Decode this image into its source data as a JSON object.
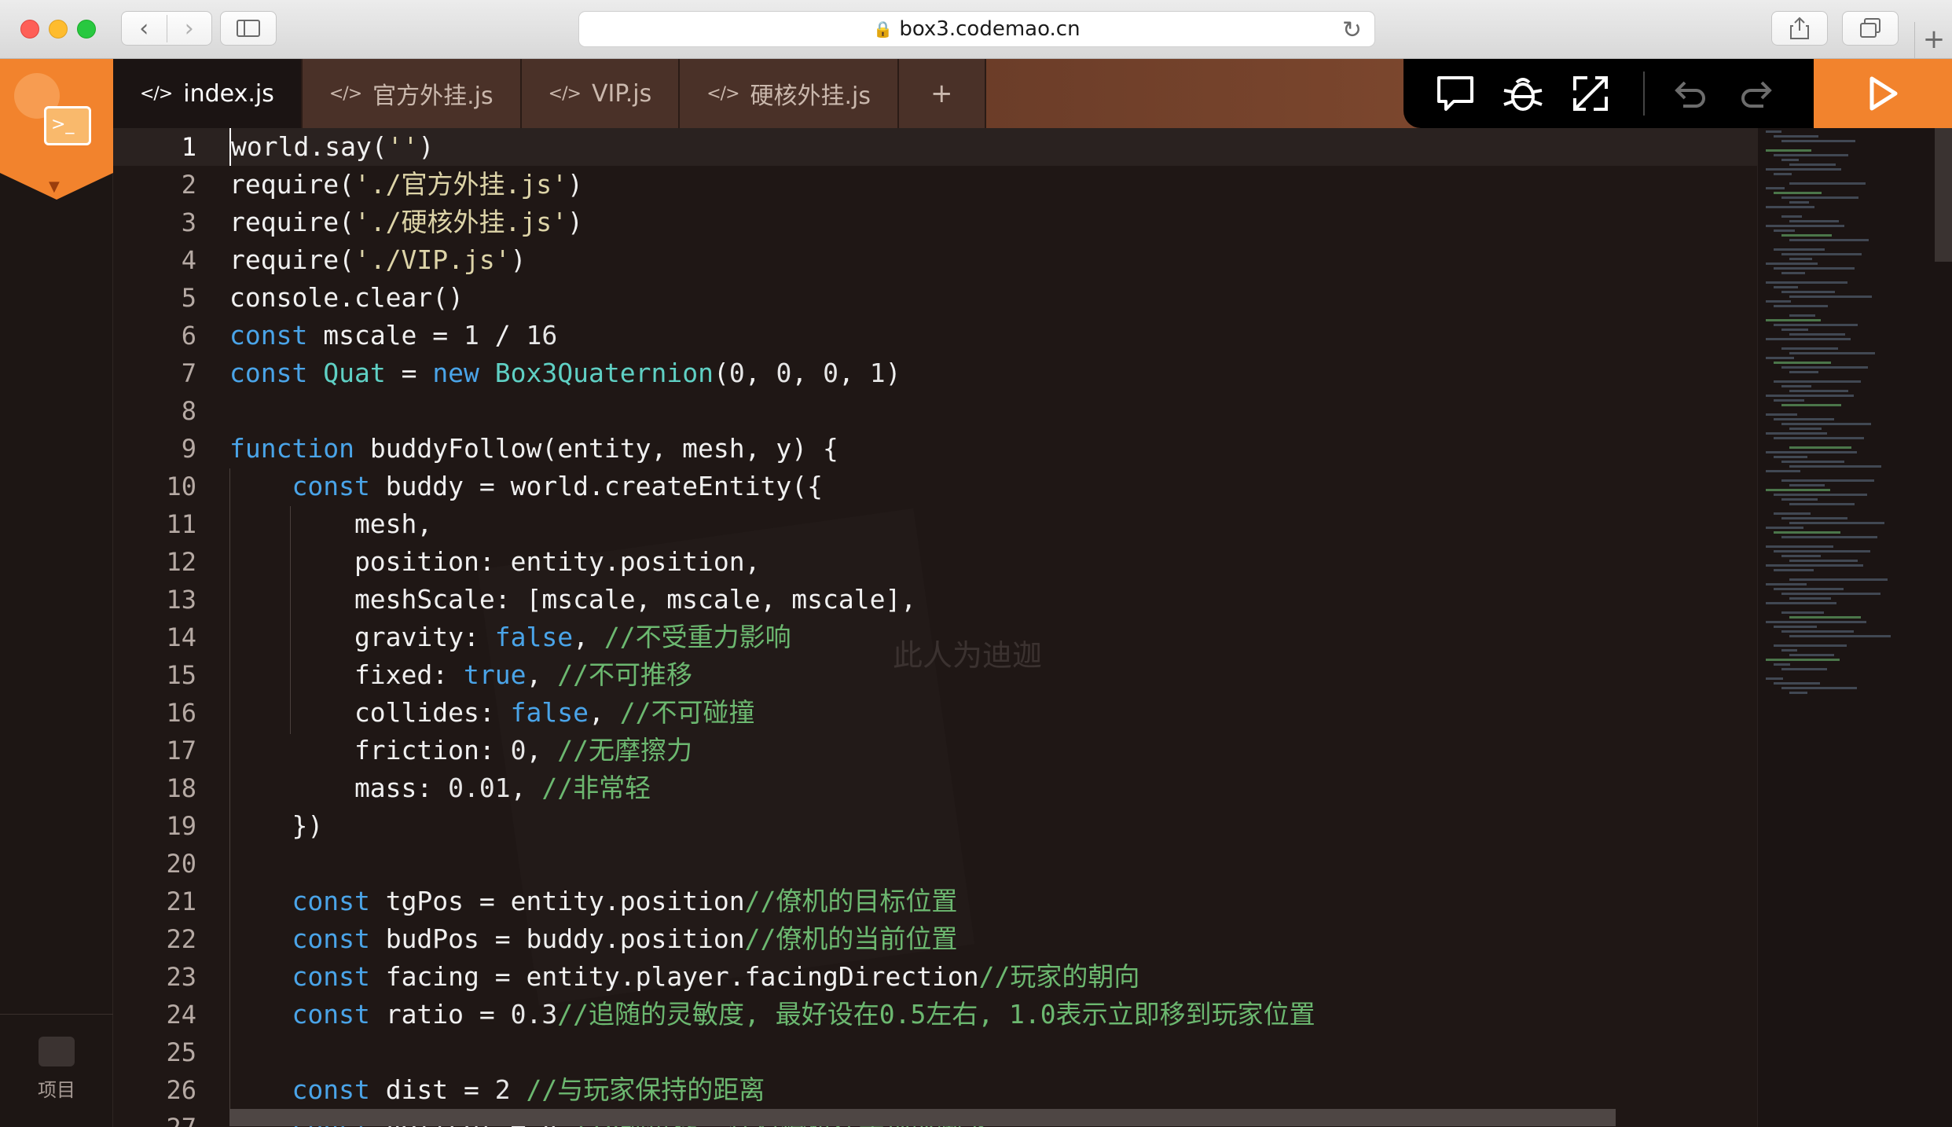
{
  "browser": {
    "url": "box3.codemao.cn",
    "new_tab_symbol": "+"
  },
  "sidebar": {
    "project_label": "项目"
  },
  "tabs": [
    {
      "label": "index.js",
      "active": true
    },
    {
      "label": "官方外挂.js",
      "active": false
    },
    {
      "label": "VIP.js",
      "active": false
    },
    {
      "label": "硬核外挂.js",
      "active": false
    }
  ],
  "tab_icon_glyph": "</>",
  "add_tab_label": "+",
  "toolbar_icons": [
    "comment-icon",
    "debug-bug-icon",
    "expand-icon",
    "undo-icon",
    "redo-icon",
    "run-play-icon"
  ],
  "colors": {
    "accent": "#f2832d",
    "keyword": "#4aa4e8",
    "class": "#5fd0c4",
    "comment": "#6cb870"
  },
  "watermark": "此人为迪迦",
  "editor": {
    "current_line": 1,
    "lines": [
      [
        {
          "t": "world.say(",
          "c": ""
        },
        {
          "t": "''",
          "c": "str"
        },
        {
          "t": ")",
          "c": ""
        }
      ],
      [
        {
          "t": "require(",
          "c": ""
        },
        {
          "t": "'./官方外挂.js'",
          "c": "str"
        },
        {
          "t": ")",
          "c": ""
        }
      ],
      [
        {
          "t": "require(",
          "c": ""
        },
        {
          "t": "'./硬核外挂.js'",
          "c": "str"
        },
        {
          "t": ")",
          "c": ""
        }
      ],
      [
        {
          "t": "require(",
          "c": ""
        },
        {
          "t": "'./VIP.js'",
          "c": "str"
        },
        {
          "t": ")",
          "c": ""
        }
      ],
      [
        {
          "t": "console.clear()",
          "c": ""
        }
      ],
      [
        {
          "t": "const",
          "c": "kw"
        },
        {
          "t": " mscale = ",
          "c": ""
        },
        {
          "t": "1",
          "c": "num"
        },
        {
          "t": " / ",
          "c": ""
        },
        {
          "t": "16",
          "c": "num"
        }
      ],
      [
        {
          "t": "const",
          "c": "kw"
        },
        {
          "t": " ",
          "c": ""
        },
        {
          "t": "Quat",
          "c": "cls"
        },
        {
          "t": " = ",
          "c": ""
        },
        {
          "t": "new",
          "c": "kw"
        },
        {
          "t": " ",
          "c": ""
        },
        {
          "t": "Box3Quaternion",
          "c": "cls"
        },
        {
          "t": "(",
          "c": ""
        },
        {
          "t": "0",
          "c": "num"
        },
        {
          "t": ", ",
          "c": ""
        },
        {
          "t": "0",
          "c": "num"
        },
        {
          "t": ", ",
          "c": ""
        },
        {
          "t": "0",
          "c": "num"
        },
        {
          "t": ", ",
          "c": ""
        },
        {
          "t": "1",
          "c": "num"
        },
        {
          "t": ")",
          "c": ""
        }
      ],
      [],
      [
        {
          "t": "function",
          "c": "kw"
        },
        {
          "t": " buddyFollow(entity, mesh, y) {",
          "c": ""
        }
      ],
      [
        {
          "t": "    ",
          "c": ""
        },
        {
          "t": "const",
          "c": "kw"
        },
        {
          "t": " buddy = world.createEntity({",
          "c": ""
        }
      ],
      [
        {
          "t": "        mesh,",
          "c": ""
        }
      ],
      [
        {
          "t": "        position: entity.position,",
          "c": ""
        }
      ],
      [
        {
          "t": "        meshScale: [mscale, mscale, mscale],",
          "c": ""
        }
      ],
      [
        {
          "t": "        gravity: ",
          "c": ""
        },
        {
          "t": "false",
          "c": "kw"
        },
        {
          "t": ", ",
          "c": ""
        },
        {
          "t": "//不受重力影响",
          "c": "cm"
        }
      ],
      [
        {
          "t": "        fixed: ",
          "c": ""
        },
        {
          "t": "true",
          "c": "kw"
        },
        {
          "t": ", ",
          "c": ""
        },
        {
          "t": "//不可推移",
          "c": "cm"
        }
      ],
      [
        {
          "t": "        collides: ",
          "c": ""
        },
        {
          "t": "false",
          "c": "kw"
        },
        {
          "t": ", ",
          "c": ""
        },
        {
          "t": "//不可碰撞",
          "c": "cm"
        }
      ],
      [
        {
          "t": "        friction: ",
          "c": ""
        },
        {
          "t": "0",
          "c": "num"
        },
        {
          "t": ", ",
          "c": ""
        },
        {
          "t": "//无摩擦力",
          "c": "cm"
        }
      ],
      [
        {
          "t": "        mass: ",
          "c": ""
        },
        {
          "t": "0.01",
          "c": "num"
        },
        {
          "t": ", ",
          "c": ""
        },
        {
          "t": "//非常轻",
          "c": "cm"
        }
      ],
      [
        {
          "t": "    })",
          "c": ""
        }
      ],
      [],
      [
        {
          "t": "    ",
          "c": ""
        },
        {
          "t": "const",
          "c": "kw"
        },
        {
          "t": " tgPos = entity.position",
          "c": ""
        },
        {
          "t": "//僚机的目标位置",
          "c": "cm"
        }
      ],
      [
        {
          "t": "    ",
          "c": ""
        },
        {
          "t": "const",
          "c": "kw"
        },
        {
          "t": " budPos = buddy.position",
          "c": ""
        },
        {
          "t": "//僚机的当前位置",
          "c": "cm"
        }
      ],
      [
        {
          "t": "    ",
          "c": ""
        },
        {
          "t": "const",
          "c": "kw"
        },
        {
          "t": " facing = entity.player.facingDirection",
          "c": ""
        },
        {
          "t": "//玩家的朝向",
          "c": "cm"
        }
      ],
      [
        {
          "t": "    ",
          "c": ""
        },
        {
          "t": "const",
          "c": "kw"
        },
        {
          "t": " ratio = ",
          "c": ""
        },
        {
          "t": "0.3",
          "c": "num"
        },
        {
          "t": "//追随的灵敏度, 最好设在0.5左右, 1.0表示立即移到玩家位置",
          "c": "cm"
        }
      ],
      [],
      [
        {
          "t": "    ",
          "c": ""
        },
        {
          "t": "const",
          "c": "kw"
        },
        {
          "t": " dist = ",
          "c": ""
        },
        {
          "t": "2",
          "c": "num"
        },
        {
          "t": " ",
          "c": ""
        },
        {
          "t": "//与玩家保持的距离",
          "c": "cm"
        }
      ],
      [
        {
          "t": "    ",
          "c": ""
        },
        {
          "t": "const",
          "c": "kw"
        },
        {
          "t": " yOffset = y ",
          "c": ""
        },
        {
          "t": "//y轴位移, 保持僚机在头顶或脚下",
          "c": "cm"
        }
      ]
    ]
  }
}
